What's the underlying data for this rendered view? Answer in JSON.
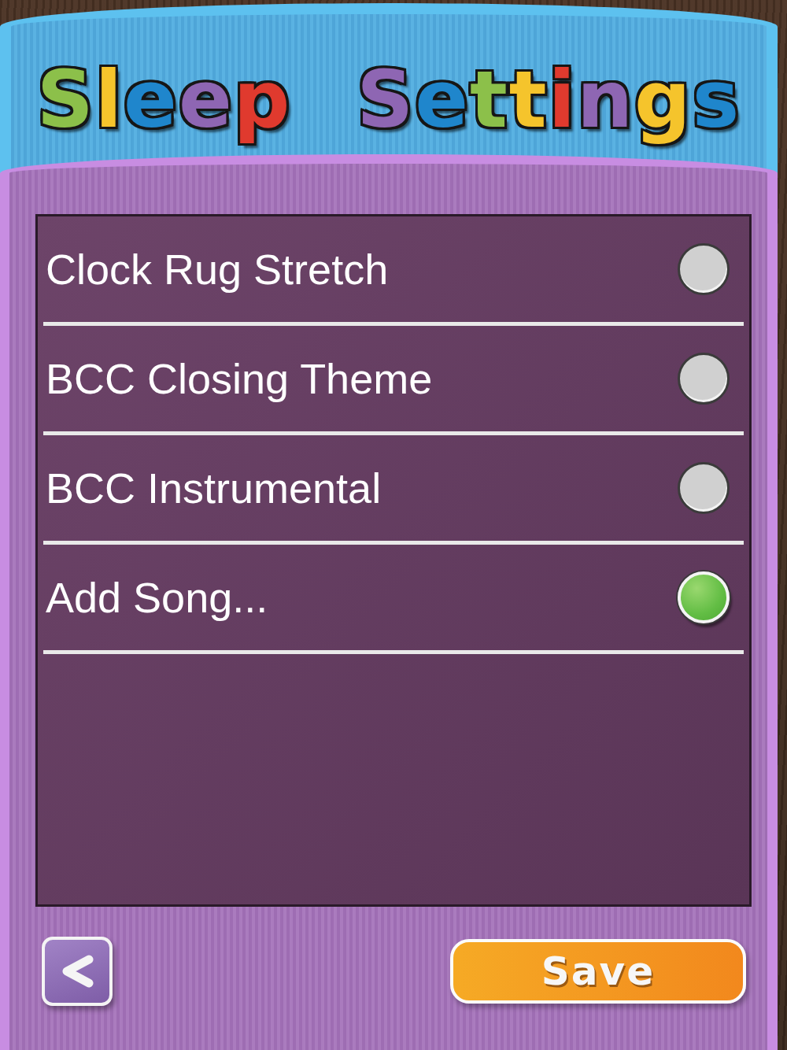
{
  "title": "Sleep Settings",
  "songs": [
    {
      "label": "Clock Rug Stretch",
      "selected": false
    },
    {
      "label": "BCC Closing Theme",
      "selected": false
    },
    {
      "label": "BCC Instrumental",
      "selected": false
    },
    {
      "label": "Add Song...",
      "selected": true
    }
  ],
  "save_button": {
    "label": "Save"
  }
}
